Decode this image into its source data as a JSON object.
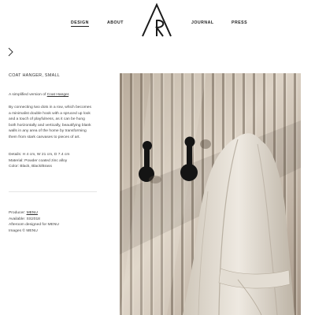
{
  "nav": {
    "links": [
      {
        "label": "DESIGN",
        "active": true
      },
      {
        "label": "ABOUT",
        "active": false
      },
      {
        "label": "JOURNAL",
        "active": false
      },
      {
        "label": "PRESS",
        "active": false
      }
    ]
  },
  "product": {
    "title": "COAT HANGER, SMALL",
    "intro_prefix": "A simplified version of ",
    "intro_link": "Coat Hanger",
    "intro_suffix": ".",
    "description_lines": [
      "By connecting two dots in a row, which becomes",
      "a minimalist double hook with a spruced up look",
      "and a touch of playfulness, as it can be hung",
      "both horizontally and vertically, beautifying blank",
      "walls in any area of the home by transforming",
      "them from stark canvases to pieces of art."
    ],
    "details": [
      "Details: H 4 cm, W 21 cm, D 7.4 cm",
      "Material: Powder coated zinc alloy",
      "Color: Black, Black/Brass"
    ],
    "producer_label": "Producer: ",
    "producer_link": "MENU",
    "available": "Available: SS2018",
    "designed_for": "Afteroom designed for MENU",
    "images_credit": "Images © MENU"
  },
  "photo": {
    "subject": "Black double coat hook on slatted wood wall with white coat hanging",
    "palette": {
      "wall": "#d8cfc3",
      "slat_shadow": "#8a7c6c",
      "hook": "#141414",
      "coat": "#e6e0d6"
    }
  },
  "icons": {
    "back": "chevron-right-icon",
    "logo": "afteroom-logo"
  }
}
